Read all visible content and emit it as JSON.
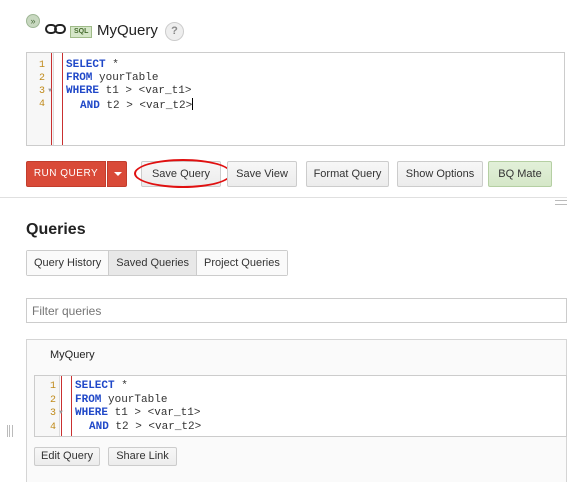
{
  "header": {
    "collapse_glyph": "»",
    "link_icon": "link-icon",
    "badge": "SQL",
    "title": "MyQuery",
    "help": "?"
  },
  "editor": {
    "lines": [
      {
        "num": "1",
        "kw": "SELECT",
        "rest": " *"
      },
      {
        "num": "2",
        "kw": "FROM",
        "rest": " yourTable"
      },
      {
        "num": "3",
        "kw": "WHERE",
        "rest": " t1 > <var_t1>"
      },
      {
        "num": "4",
        "kw": "AND",
        "rest": " t2 > <var_t2>"
      }
    ]
  },
  "toolbar": {
    "run": "RUN QUERY",
    "save_query": "Save Query",
    "save_view": "Save View",
    "format_query": "Format Query",
    "show_options": "Show Options",
    "bq_mate": "BQ Mate"
  },
  "queries": {
    "title": "Queries",
    "tabs": [
      "Query History",
      "Saved Queries",
      "Project Queries"
    ],
    "active_tab": "Saved Queries",
    "filter_placeholder": "Filter queries",
    "saved": {
      "name": "MyQuery",
      "lines": [
        {
          "num": "1",
          "kw": "SELECT",
          "rest": " *"
        },
        {
          "num": "2",
          "kw": "FROM",
          "rest": " yourTable"
        },
        {
          "num": "3",
          "kw": "WHERE",
          "rest": " t1 > <var_t1>"
        },
        {
          "num": "4",
          "kw": "AND",
          "rest": " t2 > <var_t2>"
        }
      ],
      "edit": "Edit Query",
      "share": "Share Link"
    }
  },
  "colors": {
    "run_button": "#d94a38",
    "keyword": "#2048c8",
    "highlight_ring": "#e01010",
    "bq_mate": "#d5e7c8"
  }
}
